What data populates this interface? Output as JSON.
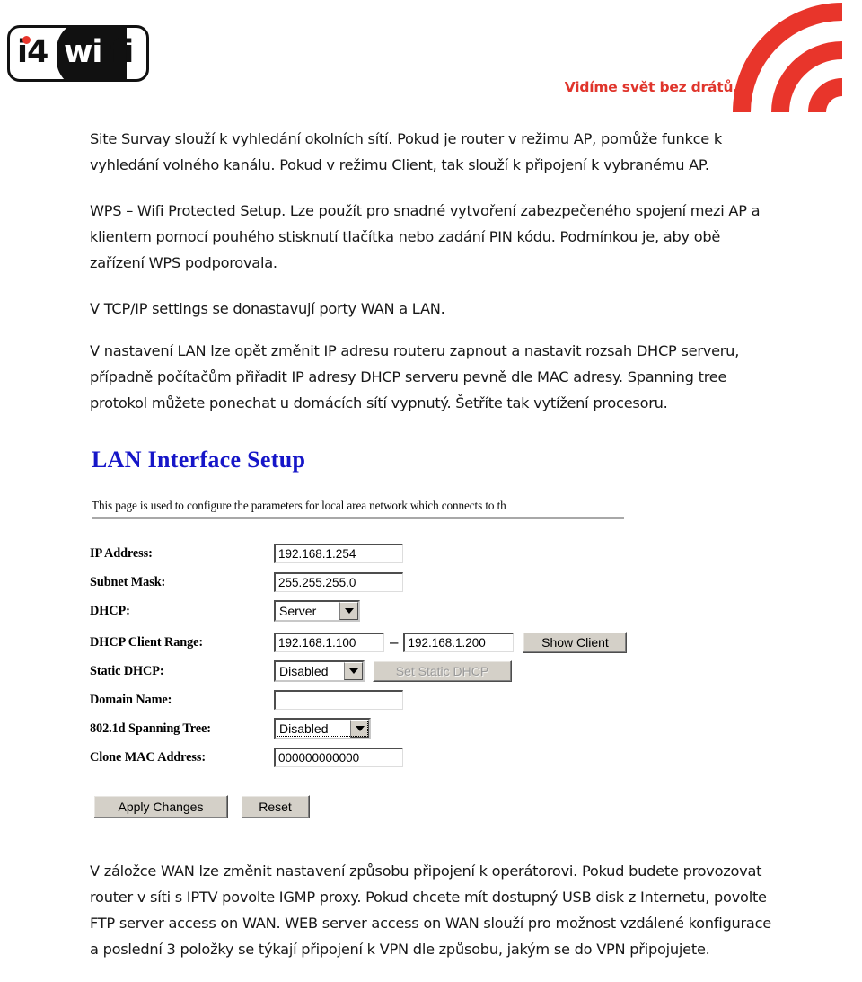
{
  "header": {
    "logo": {
      "part1": "i4",
      "part2": "wi",
      "part3": "fi",
      "alt": "i4wifi"
    },
    "tagline": "Vidíme svět bez drátů.",
    "tagline_color": "#e0352c",
    "arc_color": "#e8352b"
  },
  "intro": {
    "p1": "Site Survay slouží k vyhledání okolních sítí. Pokud je router v režimu AP, pomůže funkce k vyhledání volného kanálu. Pokud v režimu Client, tak slouží k připojení k vybranému AP.",
    "p2": "WPS – Wifi Protected Setup. Lze použít pro snadné vytvoření zabezpečeného spojení mezi AP a klientem pomocí pouhého stisknutí tlačítka nebo zadání PIN kódu. Podmínkou je, aby obě zařízení WPS podporovala.",
    "p3": "V TCP/IP settings se donastavují porty WAN a LAN.",
    "p4": "V nastavení LAN lze opět změnit IP adresu routeru zapnout a nastavit rozsah DHCP serveru, případně počítačům přiřadit IP adresy DHCP serveru pevně dle MAC adresy. Spanning tree protokol můžete ponechat u domácích sítí vypnutý. Šetříte tak vytížení procesoru."
  },
  "router_ui": {
    "title": "LAN Interface Setup",
    "title_color": "#1616c8",
    "description": "This page is used to configure the parameters for local area network which connects to th",
    "fields": [
      {
        "name": "ip-address",
        "label": "IP Address:",
        "type": "text",
        "value": "192.168.1.254"
      },
      {
        "name": "subnet-mask",
        "label": "Subnet Mask:",
        "type": "text",
        "value": "255.255.255.0"
      },
      {
        "name": "dhcp",
        "label": "DHCP:",
        "type": "select",
        "value": "Server"
      },
      {
        "name": "dhcp-client-range",
        "label": "DHCP Client Range:",
        "type": "range",
        "value_from": "192.168.1.100",
        "separator": "–",
        "value_to": "192.168.1.200",
        "button": "Show Client"
      },
      {
        "name": "static-dhcp",
        "label": "Static DHCP:",
        "type": "select-button",
        "value": "Disabled",
        "button": "Set Static DHCP",
        "button_disabled": true
      },
      {
        "name": "domain-name",
        "label": "Domain Name:",
        "type": "text",
        "value": ""
      },
      {
        "name": "spanning-tree",
        "label": "802.1d Spanning Tree:",
        "type": "select",
        "value": "Disabled",
        "focused": true
      },
      {
        "name": "clone-mac-address",
        "label": "Clone MAC Address:",
        "type": "text",
        "value": "000000000000"
      }
    ],
    "apply_button": "Apply Changes",
    "reset_button": "Reset"
  },
  "footer": {
    "p1": "V záložce WAN lze změnit nastavení způsobu připojení k operátorovi. Pokud budete provozovat router v síti s IPTV povolte IGMP proxy. Pokud chcete mít dostupný USB disk z Internetu, povolte FTP server access on WAN. WEB server access on WAN slouží pro možnost vzdálené konfigurace a poslední 3 položky se týkají připojení k VPN dle způsobu, jakým se do VPN připojujete."
  }
}
